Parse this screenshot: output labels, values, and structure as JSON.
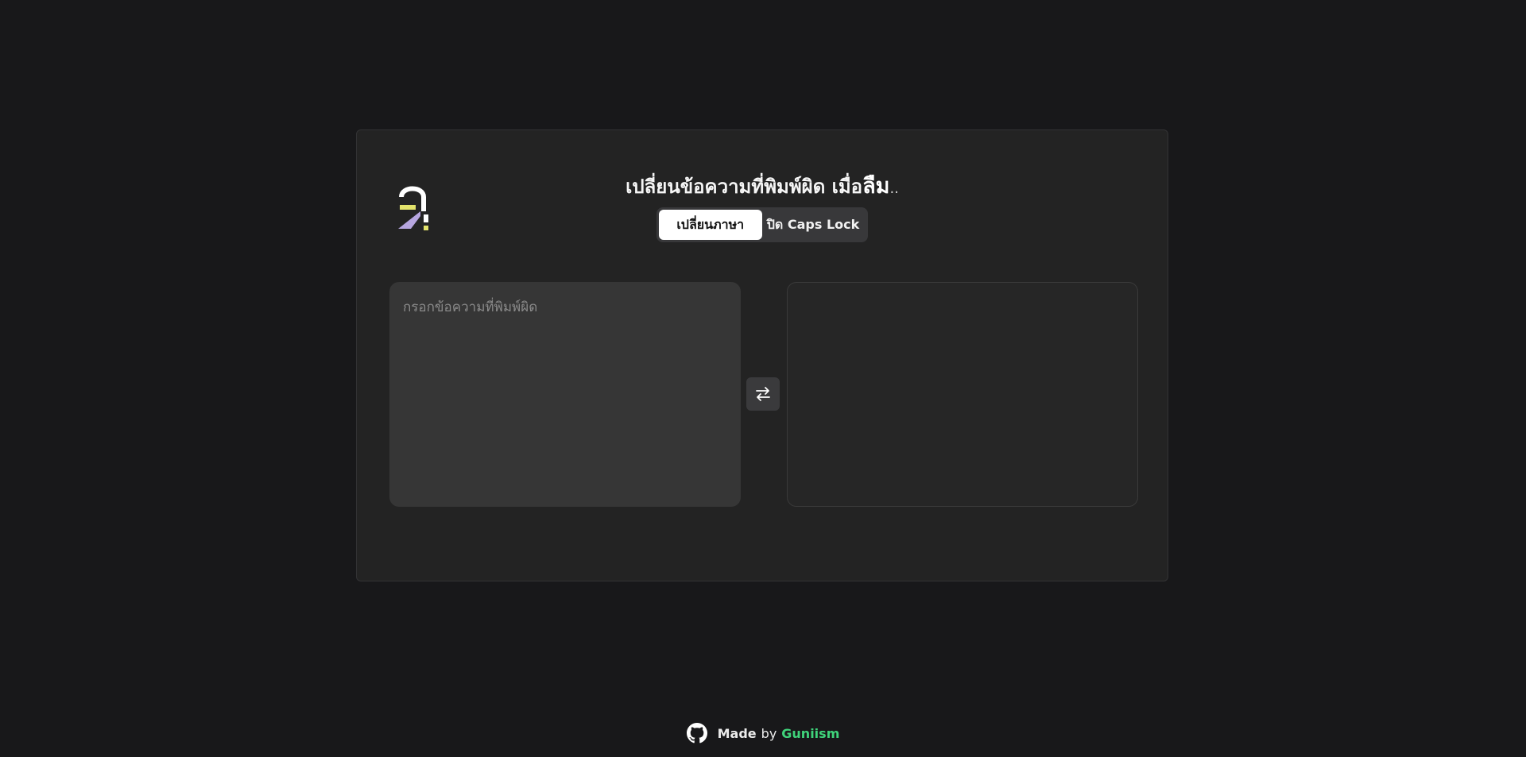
{
  "header": {
    "title_prefix": "เปลี่ยนข้อความที่พิมพ์ผิด เมื่อ",
    "title_emphasis": "ลืม",
    "title_suffix": ".."
  },
  "modes": {
    "items": [
      {
        "label": "เปลี่ยนภาษา",
        "active": true
      },
      {
        "label": "ปิด Caps Lock",
        "active": false
      }
    ]
  },
  "editor": {
    "input_placeholder": "กรอกข้อความที่พิมพ์ผิด",
    "input_value": "",
    "output_value": "",
    "swap_icon": "swap-arrows-icon"
  },
  "footer": {
    "made_label": "Made",
    "by_label": "by",
    "author": "Guniism",
    "icon": "github-icon"
  },
  "colors": {
    "background": "#18181a",
    "card": "#232323",
    "accent_green": "#3fd37a",
    "logo_yellow": "#e3e36b",
    "logo_purple": "#b7a6e0"
  }
}
